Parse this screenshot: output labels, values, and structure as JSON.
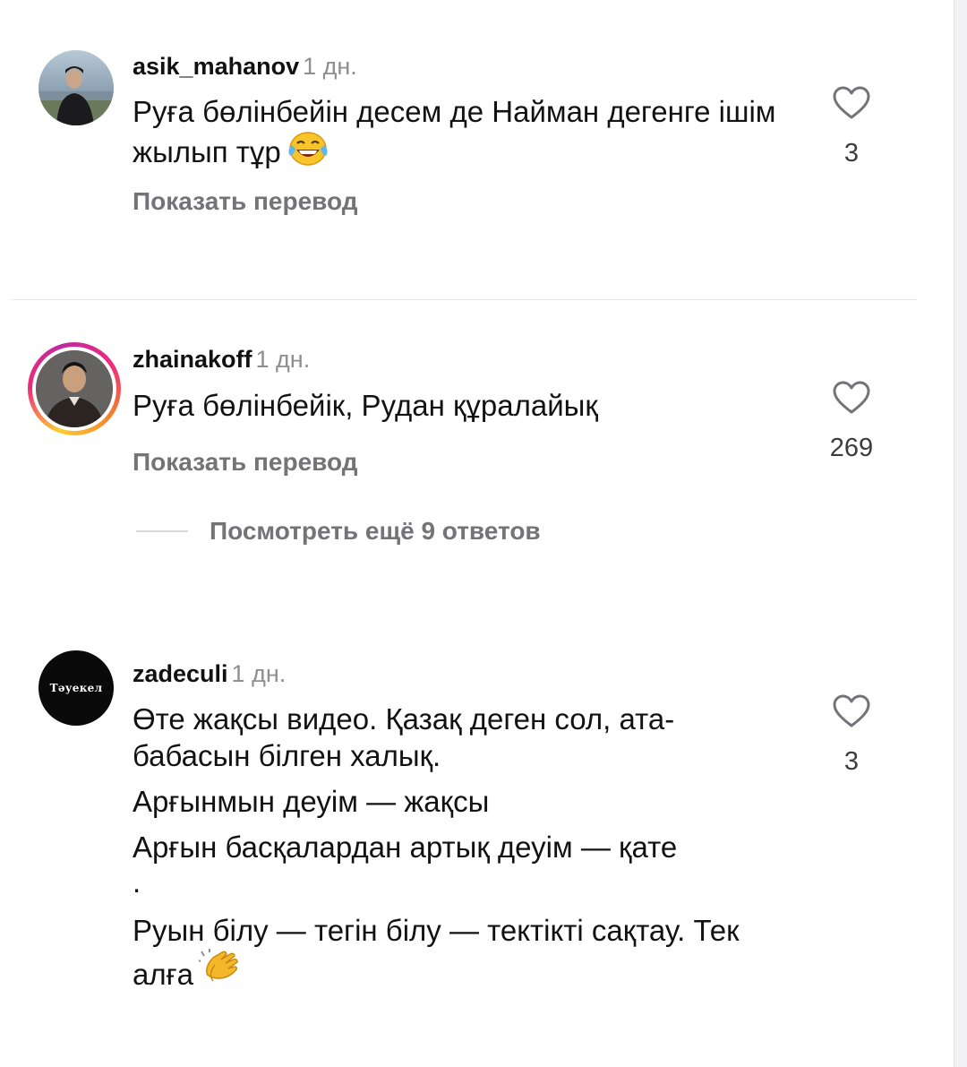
{
  "comments": [
    {
      "username": "asik_mahanov",
      "time": "1 дн.",
      "text": "Руға бөлінбейін десем де Найман дегенге ішім жылып тұр",
      "emoji": "laughing-tears",
      "translate": "Показать перевод",
      "likes": "3"
    },
    {
      "username": "zhainakoff",
      "time": "1 дн.",
      "text": "Руға бөлінбейік, Рудан құралайық",
      "translate": "Показать перевод",
      "likes": "269",
      "has_story": true,
      "view_replies": "Посмотреть ещё 9 ответов"
    },
    {
      "username": "zadeculi",
      "time": "1 дн.",
      "avatar_text": "Тәуекел",
      "paragraphs": [
        "Өте жақсы видео. Қазақ деген сол, ата-бабасын білген халық.",
        "Арғынмын деуім — жақсы",
        "Арғын басқалардан артық деуім — қате",
        ".",
        "Руын білу — тегін білу — тектікті сақтау. Тек алға"
      ],
      "emoji": "clapping-hands",
      "likes": "3"
    }
  ],
  "colors": {
    "text": "#121212",
    "secondary": "#737378",
    "time": "#8e8e93",
    "divider": "#e8e8ea"
  }
}
